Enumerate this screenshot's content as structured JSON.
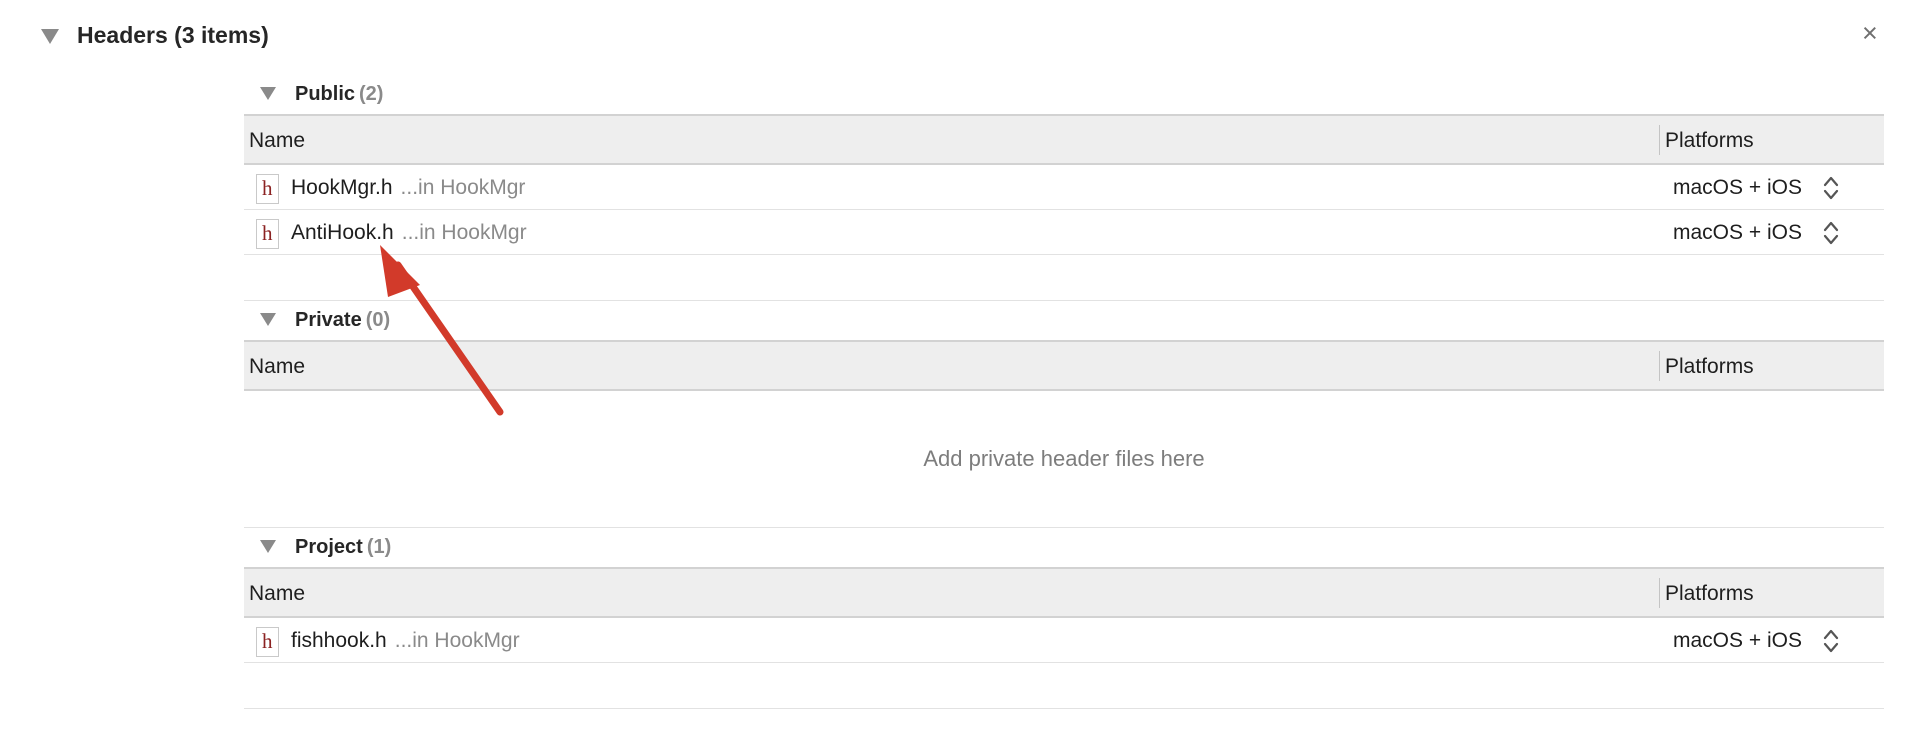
{
  "headers": {
    "title": "Headers (3 items)",
    "close_symbol": "×"
  },
  "sections": [
    {
      "title": "Public",
      "count": "(2)",
      "columns": {
        "name": "Name",
        "platforms": "Platforms"
      },
      "rows": [
        {
          "file": "HookMgr.h",
          "location": "...in HookMgr",
          "platforms": "macOS + iOS"
        },
        {
          "file": "AntiHook.h",
          "location": "...in HookMgr",
          "platforms": "macOS + iOS"
        }
      ]
    },
    {
      "title": "Private",
      "count": "(0)",
      "columns": {
        "name": "Name",
        "platforms": "Platforms"
      },
      "empty_message": "Add private header files here"
    },
    {
      "title": "Project",
      "count": "(1)",
      "columns": {
        "name": "Name",
        "platforms": "Platforms"
      },
      "rows": [
        {
          "file": "fishhook.h",
          "location": "...in HookMgr",
          "platforms": "macOS + iOS"
        }
      ]
    }
  ],
  "file_icon_glyph": "h",
  "icons": {
    "disclosure": "disclosure-triangle-icon",
    "file": "header-file-icon",
    "stepper": "up-down-stepper-icon",
    "annotation": "red-arrow-annotation"
  },
  "colors": {
    "header_band": "#eeeeee",
    "count_text": "#8a8a8a",
    "file_glyph": "#8b2222",
    "annotation_arrow": "#d23a2a"
  }
}
